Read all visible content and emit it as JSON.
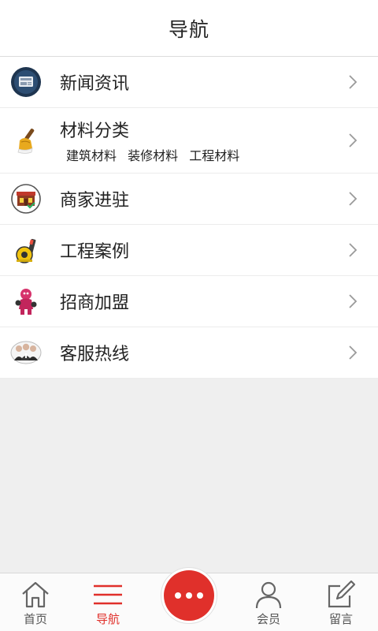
{
  "header": {
    "title": "导航"
  },
  "menu": {
    "items": [
      {
        "label": "新闻资讯",
        "icon": "news-icon"
      },
      {
        "label": "材料分类",
        "icon": "brush-icon",
        "subs": [
          "建筑材料",
          "装修材料",
          "工程材料"
        ]
      },
      {
        "label": "商家进驻",
        "icon": "storefront-icon"
      },
      {
        "label": "工程案例",
        "icon": "tape-measure-icon"
      },
      {
        "label": "招商加盟",
        "icon": "mascot-icon"
      },
      {
        "label": "客服热线",
        "icon": "service-team-icon"
      }
    ]
  },
  "tabbar": {
    "items": [
      {
        "label": "首页",
        "icon": "home-icon"
      },
      {
        "label": "导航",
        "icon": "menu-icon",
        "active": true
      },
      {
        "label": "",
        "icon": "more-icon"
      },
      {
        "label": "会员",
        "icon": "user-icon"
      },
      {
        "label": "留言",
        "icon": "edit-icon"
      }
    ]
  },
  "colors": {
    "accent": "#e0302b",
    "background": "#efefef",
    "text": "#222222"
  }
}
